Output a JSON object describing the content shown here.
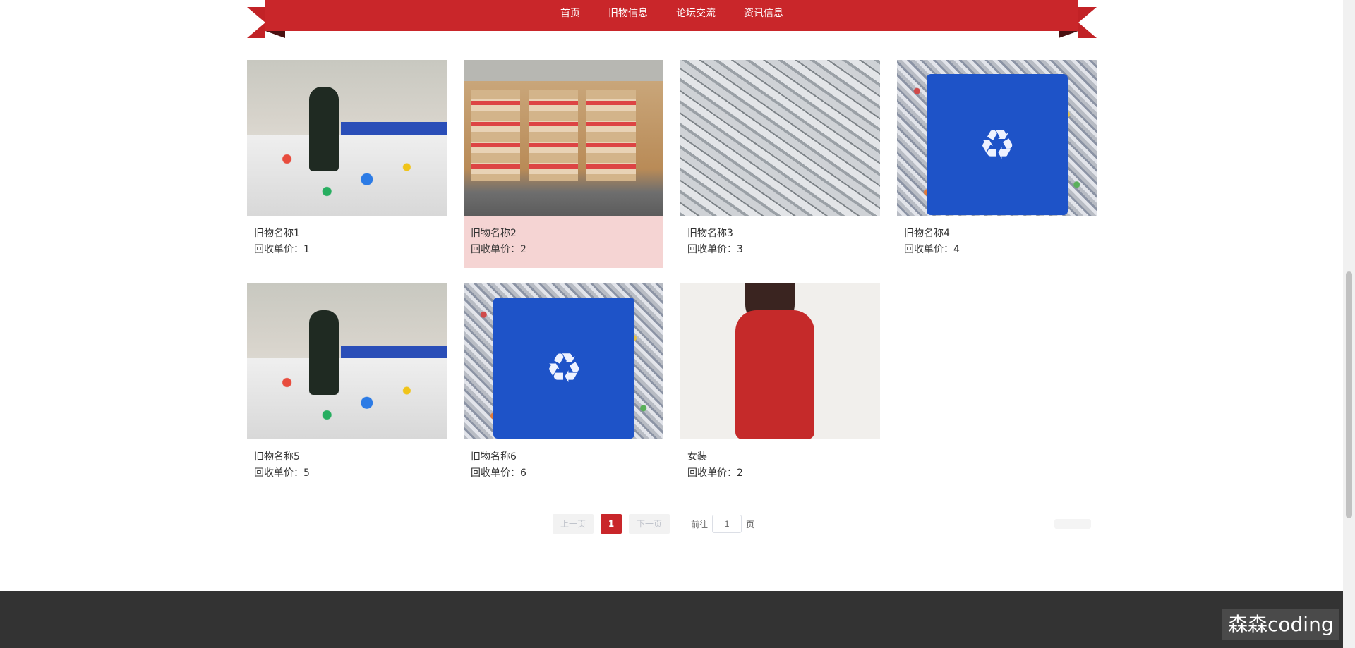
{
  "nav": {
    "items": [
      {
        "label": "首页"
      },
      {
        "label": "旧物信息"
      },
      {
        "label": "论坛交流"
      },
      {
        "label": "资讯信息"
      }
    ]
  },
  "products": [
    {
      "name": "旧物名称1",
      "price_label": "回收单价：",
      "price": "1",
      "image": "worker-recycling"
    },
    {
      "name": "旧物名称2",
      "price_label": "回收单价：",
      "price": "2",
      "image": "cardboard-bales"
    },
    {
      "name": "旧物名称3",
      "price_label": "回收单价：",
      "price": "3",
      "image": "scrap-metal"
    },
    {
      "name": "旧物名称4",
      "price_label": "回收单价：",
      "price": "4",
      "image": "recycle-bin"
    },
    {
      "name": "旧物名称5",
      "price_label": "回收单价：",
      "price": "5",
      "image": "worker-recycling"
    },
    {
      "name": "旧物名称6",
      "price_label": "回收单价：",
      "price": "6",
      "image": "recycle-bin"
    },
    {
      "name": "女装",
      "price_label": "回收单价：",
      "price": "2",
      "image": "red-sweater"
    }
  ],
  "pagination": {
    "prev": "上一页",
    "current": "1",
    "next": "下一页",
    "goto_prefix": "前往",
    "goto_value": "1",
    "goto_suffix": "页"
  },
  "watermark": "森森coding",
  "colors": {
    "brand_red": "#c9262a",
    "hover_bg": "#f5d4d3",
    "footer_bg": "#333333"
  }
}
